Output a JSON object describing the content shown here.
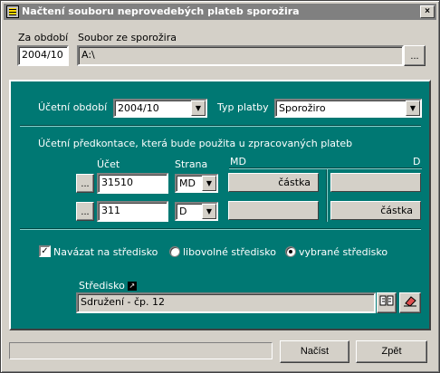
{
  "window": {
    "title": "Načtení souboru neprovedebých plateb sporožira",
    "close": "×"
  },
  "top": {
    "period_label": "Za období",
    "period_value": "2004/10",
    "file_label": "Soubor ze sporožira",
    "file_value": "A:\\",
    "browse": "..."
  },
  "panel": {
    "account_period_label": "Účetní období",
    "account_period_value": "2004/10",
    "payment_type_label": "Typ platby",
    "payment_type_value": "Sporožiro",
    "precontation_label": "Účetní předkontace, která bude použita u zpracovaných plateb",
    "col_account": "Účet",
    "col_side": "Strana",
    "col_md": "MD",
    "col_d": "D",
    "rows": [
      {
        "browse": "...",
        "account": "31510",
        "side": "MD",
        "md_amount": "částka",
        "d_amount": ""
      },
      {
        "browse": "...",
        "account": "311",
        "side": "D",
        "md_amount": "",
        "d_amount": "částka"
      }
    ],
    "link_center_label": "Navázat na středisko",
    "link_center_checked": "✓",
    "radio_any": "libovolné středisko",
    "radio_selected": "vybrané středisko",
    "center_label": "Středisko",
    "center_link_icon": "↗",
    "center_value": "Sdružení - čp. 12"
  },
  "footer": {
    "load": "Načíst",
    "back": "Zpět"
  },
  "icons": {
    "combo_arrow": "▼"
  }
}
